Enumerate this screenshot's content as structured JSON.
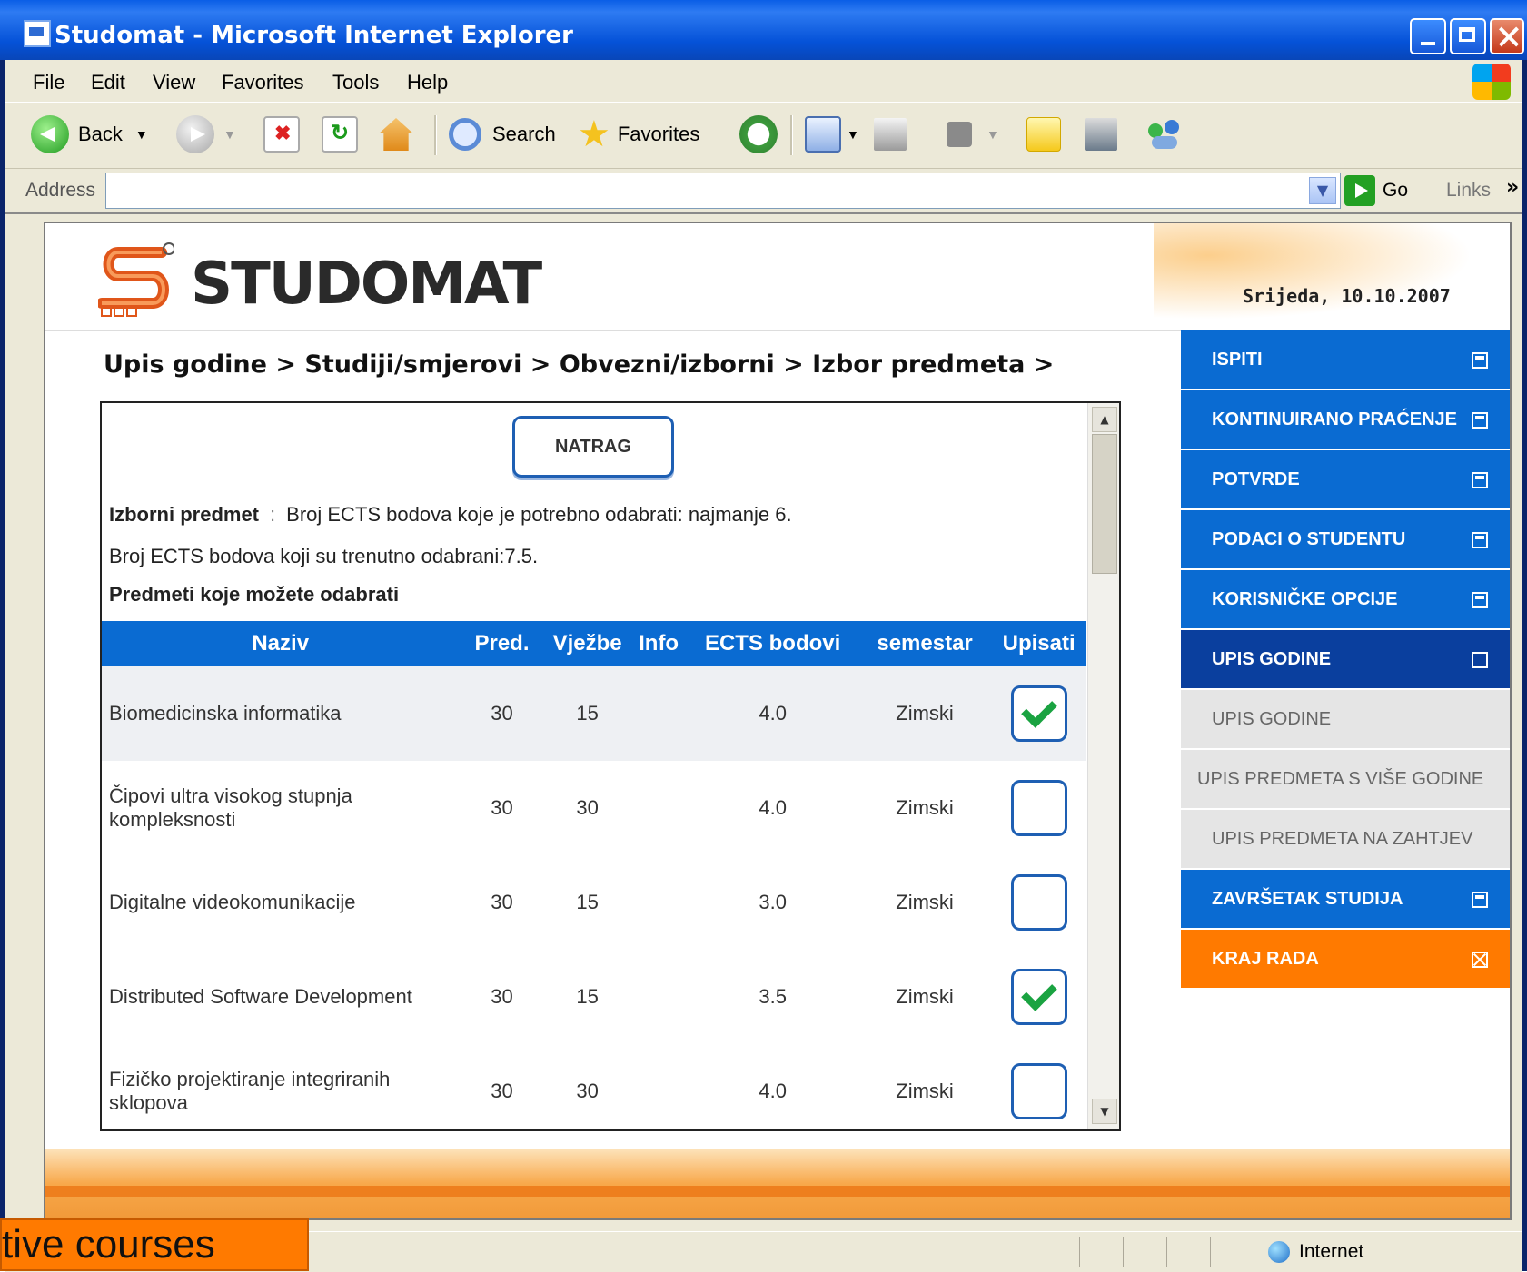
{
  "window": {
    "title": "Studomat - Microsoft Internet Explorer"
  },
  "menubar": [
    "File",
    "Edit",
    "View",
    "Favorites",
    "Tools",
    "Help"
  ],
  "toolbar": {
    "back": "Back",
    "search": "Search",
    "favorites": "Favorites"
  },
  "addressbar": {
    "label": "Address",
    "value": "",
    "go": "Go",
    "links": "Links",
    "more": "»"
  },
  "page": {
    "logo": "STUDOMAT",
    "date": "Srijeda, 10.10.2007",
    "breadcrumb": "Upis godine > Studiji/smjerovi > Obvezni/izborni > Izbor predmeta >",
    "back_button": "NATRAG",
    "elective_label": "Izborni predmet",
    "elective_sep": ":",
    "required_text": "Broj ECTS bodova koje je potrebno odabrati: najmanje 6.",
    "selected_text": "Broj ECTS bodova koji su trenutno odabrani:7.5.",
    "available_heading": "Predmeti koje možete odabrati",
    "table": {
      "headers": [
        "Naziv",
        "Pred.",
        "Vježbe",
        "Info",
        "ECTS bodovi",
        "semestar",
        "Upisati"
      ],
      "rows": [
        {
          "name": "Biomedicinska informatika",
          "pred": "30",
          "vjezbe": "15",
          "info": "",
          "ects": "4.0",
          "semestar": "Zimski",
          "selected": true
        },
        {
          "name": "Čipovi ultra visokog stupnja kompleksnosti",
          "pred": "30",
          "vjezbe": "30",
          "info": "",
          "ects": "4.0",
          "semestar": "Zimski",
          "selected": false
        },
        {
          "name": "Digitalne videokomunikacije",
          "pred": "30",
          "vjezbe": "15",
          "info": "",
          "ects": "3.0",
          "semestar": "Zimski",
          "selected": false
        },
        {
          "name": "Distributed Software Development",
          "pred": "30",
          "vjezbe": "15",
          "info": "",
          "ects": "3.5",
          "semestar": "Zimski",
          "selected": true
        },
        {
          "name": "Fizičko projektiranje integriranih sklopova",
          "pred": "30",
          "vjezbe": "30",
          "info": "",
          "ects": "4.0",
          "semestar": "Zimski",
          "selected": false
        }
      ]
    },
    "nav": [
      {
        "label": "ISPITI",
        "type": "item"
      },
      {
        "label": "KONTINUIRANO PRAĆENJE",
        "type": "item"
      },
      {
        "label": "POTVRDE",
        "type": "item"
      },
      {
        "label": "PODACI O STUDENTU",
        "type": "item"
      },
      {
        "label": "KORISNIČKE OPCIJE",
        "type": "item"
      },
      {
        "label": "UPIS GODINE",
        "type": "active"
      },
      {
        "label": "UPIS GODINE",
        "type": "sub"
      },
      {
        "label": "UPIS PREDMETA S VIŠE GODINE",
        "type": "sub"
      },
      {
        "label": "UPIS PREDMETA NA ZAHTJEV",
        "type": "sub"
      },
      {
        "label": "ZAVRŠETAK STUDIJA",
        "type": "item"
      },
      {
        "label": "KRAJ RADA",
        "type": "orange"
      }
    ]
  },
  "statusbar": {
    "zone": "Internet"
  },
  "caption": "ctive courses",
  "colors": {
    "nav_blue": "#0a6bd2",
    "nav_active": "#0a3f9e",
    "nav_orange": "#ff7a00",
    "check_green": "#1aa341"
  }
}
